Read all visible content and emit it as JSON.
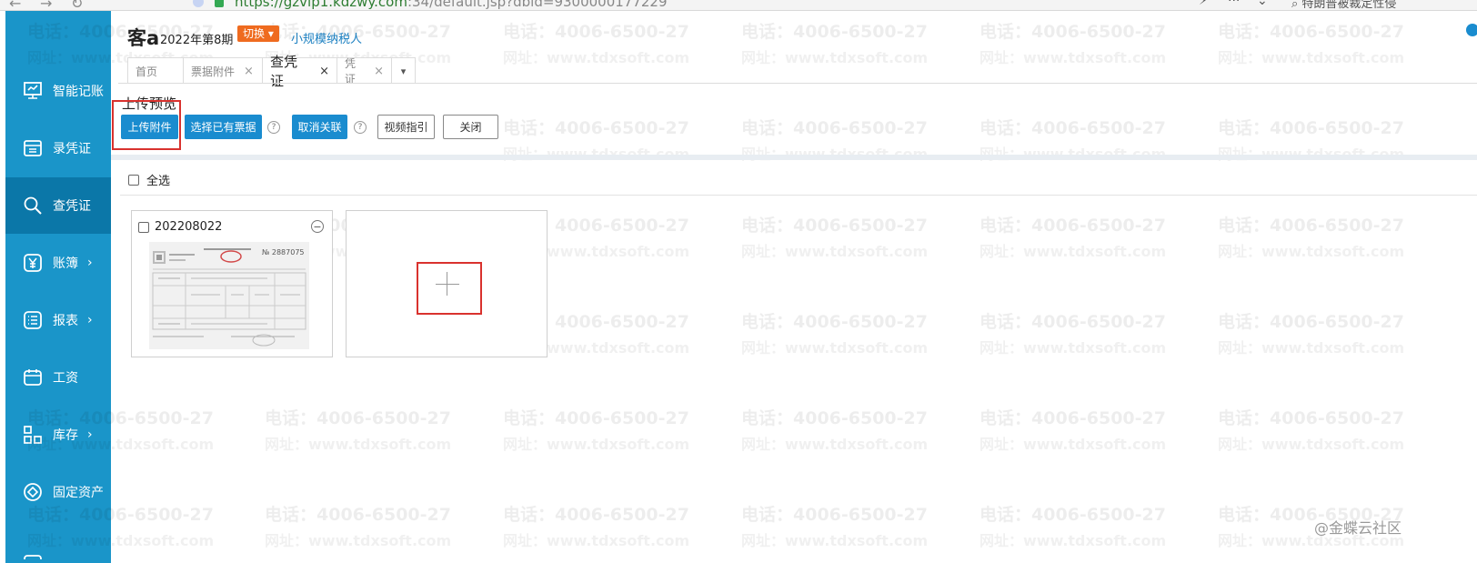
{
  "browser": {
    "url_host": "https://gzvip1.kdzwy.com",
    "url_rest": ":34/default.jsp?dbid=9300000177229",
    "search_text": "特朗普被裁定性侵"
  },
  "header": {
    "company": "客a",
    "period": "2022年第8期",
    "switch_label": "切换",
    "taxpayer_type": "小规模纳税人"
  },
  "sidebar": {
    "items": [
      {
        "label": "智能记账",
        "icon": "smart-booking-icon",
        "active": false
      },
      {
        "label": "录凭证",
        "icon": "voucher-entry-icon",
        "active": false
      },
      {
        "label": "查凭证",
        "icon": "search-icon",
        "active": true
      },
      {
        "label": "账簿",
        "icon": "yen-icon",
        "active": false,
        "arrow": "›"
      },
      {
        "label": "报表",
        "icon": "report-icon",
        "active": false,
        "arrow": "›"
      },
      {
        "label": "工资",
        "icon": "salary-icon",
        "active": false
      },
      {
        "label": "库存",
        "icon": "inventory-icon",
        "active": false,
        "arrow": "›"
      },
      {
        "label": "固定资产",
        "icon": "fixed-asset-icon",
        "active": false
      }
    ]
  },
  "tabs": [
    {
      "label": "首页",
      "closable": false,
      "active": false
    },
    {
      "label": "票据附件",
      "closable": true,
      "active": false
    },
    {
      "label": "查凭证",
      "closable": true,
      "active": true
    },
    {
      "label": "凭证",
      "closable": true,
      "active": false
    }
  ],
  "tab_close_glyph": "×",
  "tab_more_glyph": "▾",
  "page": {
    "section_title": "上传预览",
    "buttons": {
      "upload": "上传附件",
      "select_existing": "选择已有票据",
      "cancel_link": "取消关联",
      "video_guide": "视频指引",
      "close": "关闭"
    },
    "help_glyph": "?",
    "select_all": "全选",
    "attachments": [
      {
        "name": "202208022"
      }
    ],
    "remove_glyph": "−"
  },
  "watermark": {
    "phone": "电话：4006-6500-27",
    "site": "网址：www.tdxsoft.com"
  },
  "corner_mark": "@金蝶云社区",
  "colors": {
    "sidebar": "#1a95c9",
    "sidebar_active": "#0b77a8",
    "primary_button": "#1a8ccf",
    "switch_button": "#ef6b1f",
    "highlight_box": "#d9322e"
  }
}
